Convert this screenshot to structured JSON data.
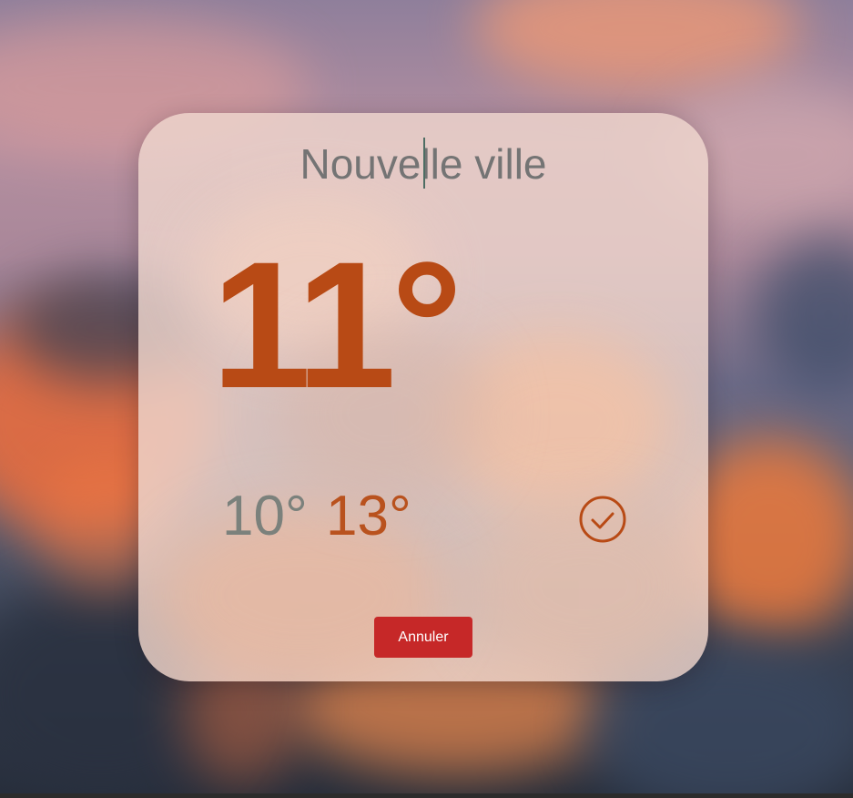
{
  "weather_card": {
    "city_input": {
      "value": "Nouvelle ville",
      "placeholder": "Nouvelle ville"
    },
    "temperature": "11°",
    "min_temperature": "10°",
    "max_temperature": "13°",
    "confirm_icon": "check-circle-icon",
    "cancel_label": "Annuler"
  },
  "colors": {
    "temperature": "#b84a15",
    "min_temperature": "#7b817c",
    "max_temperature": "#b9521e",
    "confirm_icon": "#b84a15",
    "cancel_button": "#c62828",
    "city_input_text": "#747474"
  }
}
